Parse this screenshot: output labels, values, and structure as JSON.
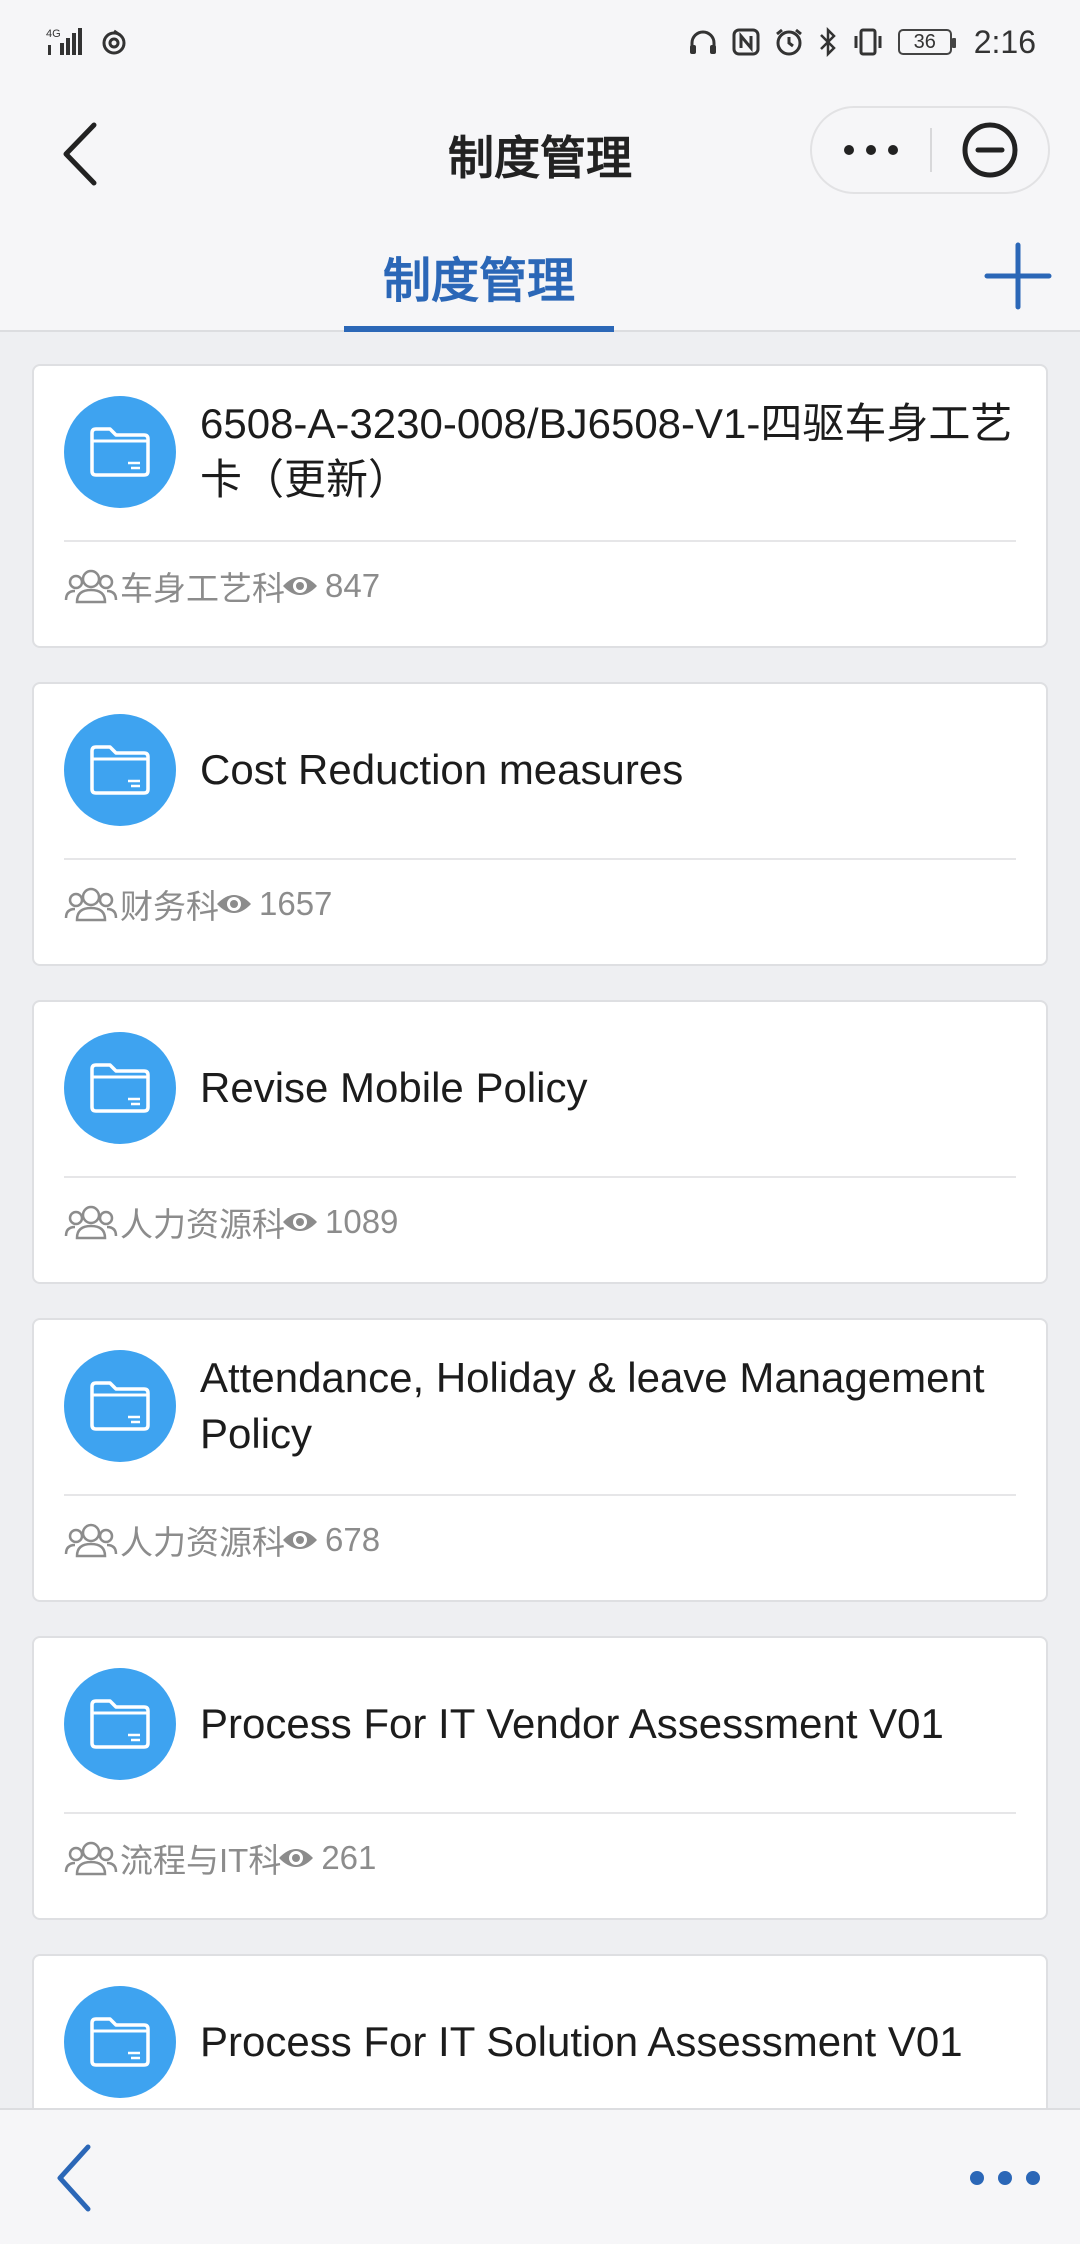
{
  "status_bar": {
    "network_label": "4G",
    "battery_level": "36",
    "time": "2:16"
  },
  "nav": {
    "title": "制度管理",
    "back_icon": "chevron-left-icon",
    "more_icon": "more-dots-icon",
    "close_icon": "circle-minus-icon"
  },
  "tabs": {
    "active_label": "制度管理",
    "add_icon": "plus-icon",
    "accent_color": "#2b67b7"
  },
  "list": {
    "icon_color": "#3ea3f0",
    "items": [
      {
        "title": "6508-A-3230-008/BJ6508-V1-四驱车身工艺卡（更新）",
        "department": "车身工艺科",
        "views": "847"
      },
      {
        "title": "Cost Reduction measures",
        "department": "财务科",
        "views": "1657"
      },
      {
        "title": "Revise Mobile Policy",
        "department": "人力资源科",
        "views": "1089"
      },
      {
        "title": "Attendance, Holiday & leave Management Policy",
        "department": "人力资源科",
        "views": "678"
      },
      {
        "title": "Process For IT Vendor Assessment V01",
        "department": "流程与IT科",
        "views": "261"
      },
      {
        "title": "Process For IT Solution Assessment V01",
        "department": "",
        "views": ""
      }
    ]
  },
  "bottom_bar": {
    "back_icon": "chevron-left-icon",
    "more_icon": "more-dots-icon",
    "accent_color": "#2b67b7"
  }
}
